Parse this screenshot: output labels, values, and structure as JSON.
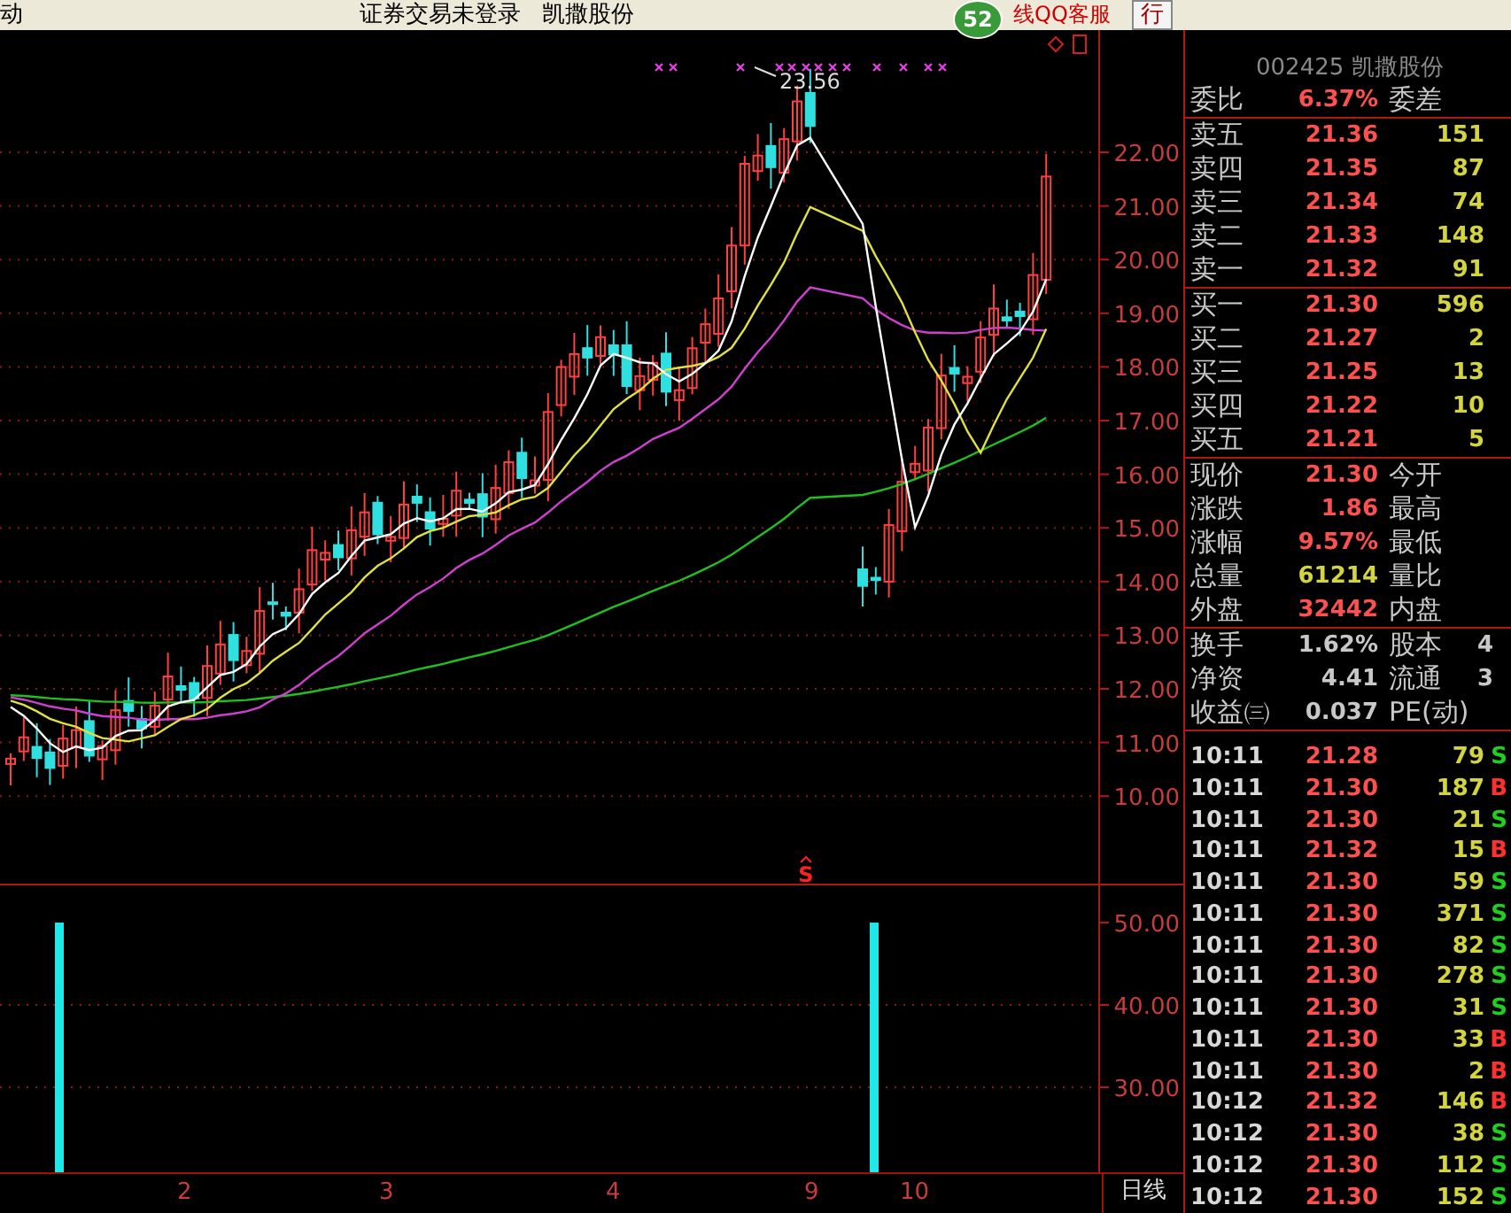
{
  "top_bar": {
    "items": [
      {
        "kind": "text",
        "label": "动"
      },
      {
        "kind": "text",
        "label": "证券交易未登录"
      },
      {
        "kind": "text",
        "label": "凯撒股份"
      },
      {
        "kind": "badge",
        "label": "52"
      },
      {
        "kind": "link",
        "label": "线QQ客服"
      },
      {
        "kind": "button",
        "label": "行"
      }
    ]
  },
  "price_chart": {
    "peak_label": "23.56",
    "signal": "S",
    "price_axis": [
      "22.00",
      "21.00",
      "20.00",
      "19.00",
      "18.00",
      "17.00",
      "16.00",
      "15.00",
      "14.00",
      "13.00",
      "12.00",
      "11.00",
      "10.00"
    ]
  },
  "indicator": {
    "axis": [
      "50.00",
      "40.00",
      "30.00"
    ]
  },
  "x_axis": {
    "labels": [
      "2",
      "3",
      "4",
      "9",
      "10"
    ],
    "period_tab": "日线"
  },
  "quote_panel": {
    "header": "002425 凯撒股份",
    "ratio_row": {
      "label": "委比",
      "value": "6.37%",
      "label2": "委差"
    },
    "sell": [
      {
        "label": "卖五",
        "price": "21.36",
        "volume": "151"
      },
      {
        "label": "卖四",
        "price": "21.35",
        "volume": "87"
      },
      {
        "label": "卖三",
        "price": "21.34",
        "volume": "74"
      },
      {
        "label": "卖二",
        "price": "21.33",
        "volume": "148"
      },
      {
        "label": "卖一",
        "price": "21.32",
        "volume": "91"
      }
    ],
    "buy": [
      {
        "label": "买一",
        "price": "21.30",
        "volume": "596"
      },
      {
        "label": "买二",
        "price": "21.27",
        "volume": "2"
      },
      {
        "label": "买三",
        "price": "21.25",
        "volume": "13"
      },
      {
        "label": "买四",
        "price": "21.22",
        "volume": "10"
      },
      {
        "label": "买五",
        "price": "21.21",
        "volume": "5"
      }
    ],
    "stats": [
      {
        "label": "现价",
        "value": "21.30",
        "color": "#ff5050",
        "label2": "今开"
      },
      {
        "label": "涨跌",
        "value": "1.86",
        "color": "#ff5050",
        "label2": "最高"
      },
      {
        "label": "涨幅",
        "value": "9.57%",
        "color": "#ff5050",
        "label2": "最低"
      },
      {
        "label": "总量",
        "value": "61214",
        "color": "#d4d43c",
        "label2": "量比"
      },
      {
        "label": "外盘",
        "value": "32442",
        "color": "#ff5050",
        "label2": "内盘"
      }
    ],
    "stats2": [
      {
        "label": "换手",
        "value": "1.62%",
        "color": "#c8c8c8",
        "label2": "股本",
        "value2": "4"
      },
      {
        "label": "净资",
        "value": "4.41",
        "color": "#c8c8c8",
        "label2": "流通",
        "value2": "3"
      },
      {
        "label": "收益㈢",
        "value": "0.037",
        "color": "#c8c8c8",
        "label2": "PE(动)"
      }
    ],
    "trades": [
      {
        "time": "10:11",
        "price": "21.28",
        "volume": "79",
        "flag": "S",
        "color": "#20d020"
      },
      {
        "time": "10:11",
        "price": "21.30",
        "volume": "187",
        "flag": "B",
        "color": "#ff3030"
      },
      {
        "time": "10:11",
        "price": "21.30",
        "volume": "21",
        "flag": "S",
        "color": "#20d020"
      },
      {
        "time": "10:11",
        "price": "21.32",
        "volume": "15",
        "flag": "B",
        "color": "#ff3030"
      },
      {
        "time": "10:11",
        "price": "21.30",
        "volume": "59",
        "flag": "S",
        "color": "#20d020"
      },
      {
        "time": "10:11",
        "price": "21.30",
        "volume": "371",
        "flag": "S",
        "color": "#20d020"
      },
      {
        "time": "10:11",
        "price": "21.30",
        "volume": "82",
        "flag": "S",
        "color": "#20d020"
      },
      {
        "time": "10:11",
        "price": "21.30",
        "volume": "278",
        "flag": "S",
        "color": "#20d020"
      },
      {
        "time": "10:11",
        "price": "21.30",
        "volume": "31",
        "flag": "S",
        "color": "#20d020"
      },
      {
        "time": "10:11",
        "price": "21.30",
        "volume": "33",
        "flag": "B",
        "color": "#ff3030"
      },
      {
        "time": "10:11",
        "price": "21.30",
        "volume": "2",
        "flag": "B",
        "color": "#ff3030"
      },
      {
        "time": "10:12",
        "price": "21.32",
        "volume": "146",
        "flag": "B",
        "color": "#ff3030"
      },
      {
        "time": "10:12",
        "price": "21.30",
        "volume": "38",
        "flag": "S",
        "color": "#20d020"
      },
      {
        "time": "10:12",
        "price": "21.30",
        "volume": "112",
        "flag": "S",
        "color": "#20d020"
      },
      {
        "time": "10:12",
        "price": "21.30",
        "volume": "152",
        "flag": "S",
        "color": "#20d020"
      }
    ]
  }
}
